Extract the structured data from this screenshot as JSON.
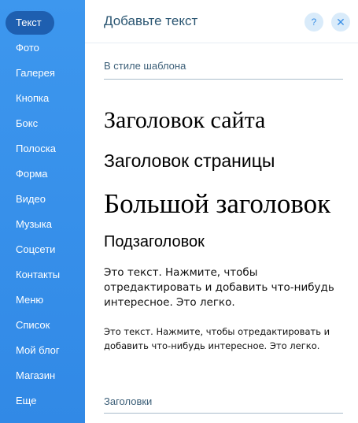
{
  "sidebar": {
    "items": [
      {
        "label": "Текст",
        "active": true
      },
      {
        "label": "Фото"
      },
      {
        "label": "Галерея"
      },
      {
        "label": "Кнопка"
      },
      {
        "label": "Бокс"
      },
      {
        "label": "Полоска"
      },
      {
        "label": "Форма"
      },
      {
        "label": "Видео"
      },
      {
        "label": "Музыка"
      },
      {
        "label": "Соцсети"
      },
      {
        "label": "Контакты"
      },
      {
        "label": "Меню"
      },
      {
        "label": "Список"
      },
      {
        "label": "Мой блог"
      },
      {
        "label": "Магазин"
      },
      {
        "label": "Еще"
      }
    ]
  },
  "panel": {
    "title": "Добавьте текст",
    "help_label": "?",
    "close_label": "✕",
    "section_template": "В стиле шаблона",
    "samples": {
      "site_title": "Заголовок сайта",
      "page_title": "Заголовок страницы",
      "large_heading": "Большой заголовок",
      "subheading": "Подзаголовок",
      "paragraph_large": "Это текст. Нажмите, чтобы отредактировать и добавить что-нибудь интересное. Это легко.",
      "paragraph_small": "Это текст. Нажмите, чтобы отредактировать и добавить что-нибудь интересное. Это легко."
    },
    "section_headings": "Заголовки"
  },
  "colors": {
    "sidebar_bg": "#3d97ee",
    "active_item_bg": "#1e5fb0",
    "title_text": "#2b5672",
    "icon_button_bg": "#d9ebfa",
    "icon_button_fg": "#3a8fe6"
  }
}
